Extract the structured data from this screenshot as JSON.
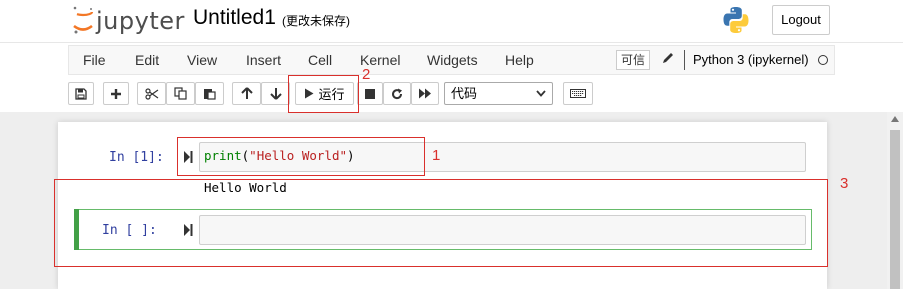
{
  "header": {
    "brand": "jupyter",
    "notebook_title": "Untitled1",
    "save_status": "(更改未保存)",
    "logout_label": "Logout"
  },
  "menu": {
    "items": [
      "File",
      "Edit",
      "View",
      "Insert",
      "Cell",
      "Kernel",
      "Widgets",
      "Help"
    ],
    "trusted_label": "可信",
    "kernel_name": "Python 3 (ipykernel)"
  },
  "toolbar": {
    "run_label": "运行",
    "cell_type": "代码",
    "buttons": [
      "save-icon",
      "plus-icon",
      "cut-icon",
      "copy-icon",
      "paste-icon",
      "arrow-up-icon",
      "arrow-down-icon",
      "play-icon",
      "stop-icon",
      "restart-icon",
      "fast-forward-icon",
      "keyboard-icon"
    ]
  },
  "cells": [
    {
      "prompt": "In  [1]:",
      "code_func": "print",
      "code_open": "(",
      "code_string": "\"Hello World\"",
      "code_close": ")",
      "output": "Hello World"
    },
    {
      "prompt": "In  [ ]:",
      "code": ""
    }
  ],
  "annotations": {
    "label1": "1",
    "label2": "2",
    "label3": "3",
    "color": "#d9302c"
  }
}
